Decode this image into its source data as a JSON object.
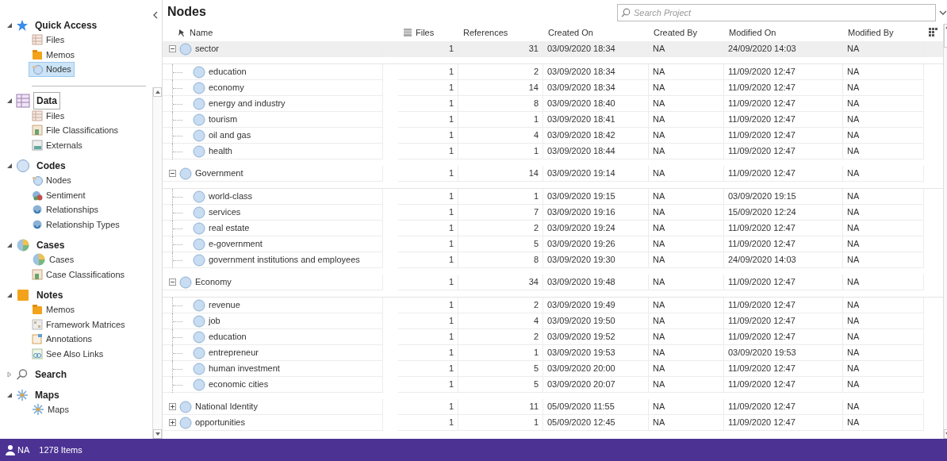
{
  "sidebar": {
    "quick_access": {
      "title": "Quick Access",
      "kind": "star",
      "expanded": true,
      "selected": false,
      "items": [
        {
          "label": "Files",
          "kind": "files",
          "selected": false
        },
        {
          "label": "Memos",
          "kind": "memos",
          "selected": false
        },
        {
          "label": "Nodes",
          "kind": "nodes",
          "selected": true
        }
      ]
    },
    "groups": [
      {
        "title": "Data",
        "kind": "data",
        "expanded": true,
        "selected": true,
        "items": [
          {
            "label": "Files",
            "kind": "files",
            "selected": false
          },
          {
            "label": "File Classifications",
            "kind": "classifications",
            "selected": false
          },
          {
            "label": "Externals",
            "kind": "externals",
            "selected": false
          }
        ]
      },
      {
        "title": "Codes",
        "kind": "codes",
        "expanded": true,
        "selected": false,
        "items": [
          {
            "label": "Nodes",
            "kind": "nodes",
            "selected": false
          },
          {
            "label": "Sentiment",
            "kind": "sentiment",
            "selected": false
          },
          {
            "label": "Relationships",
            "kind": "relationships",
            "selected": false
          },
          {
            "label": "Relationship Types",
            "kind": "relationships",
            "selected": false
          }
        ]
      },
      {
        "title": "Cases",
        "kind": "cases",
        "expanded": true,
        "selected": false,
        "items": [
          {
            "label": "Cases",
            "kind": "cases",
            "selected": false
          },
          {
            "label": "Case Classifications",
            "kind": "classifications",
            "selected": false
          }
        ]
      },
      {
        "title": "Notes",
        "kind": "notes",
        "expanded": true,
        "selected": false,
        "items": [
          {
            "label": "Memos",
            "kind": "memos",
            "selected": false
          },
          {
            "label": "Framework Matrices",
            "kind": "matrices",
            "selected": false
          },
          {
            "label": "Annotations",
            "kind": "annotations",
            "selected": false
          },
          {
            "label": "See Also Links",
            "kind": "links",
            "selected": false
          }
        ]
      },
      {
        "title": "Search",
        "kind": "search",
        "expanded": false,
        "selected": false
      },
      {
        "title": "Maps",
        "kind": "maps",
        "expanded": true,
        "selected": false,
        "items": [
          {
            "label": "Maps",
            "kind": "maps",
            "selected": false
          }
        ]
      }
    ]
  },
  "main": {
    "title": "Nodes",
    "search": {
      "placeholder": "Search Project"
    },
    "columns": [
      "Name",
      "Files",
      "References",
      "Created On",
      "Created By",
      "Modified On",
      "Modified By"
    ],
    "rows": [
      {
        "name": "sector",
        "files": "1",
        "references": "31",
        "created_on": "03/09/2020 18:34",
        "created_by": "NA",
        "modified_on": "24/09/2020 14:03",
        "modified_by": "NA",
        "expanded": true,
        "selected": true,
        "children": [
          {
            "name": "education",
            "files": "1",
            "references": "2",
            "created_on": "03/09/2020 18:34",
            "created_by": "NA",
            "modified_on": "11/09/2020 12:47",
            "modified_by": "NA",
            "selected": false
          },
          {
            "name": "economy",
            "files": "1",
            "references": "14",
            "created_on": "03/09/2020 18:34",
            "created_by": "NA",
            "modified_on": "11/09/2020 12:47",
            "modified_by": "NA",
            "selected": false
          },
          {
            "name": "energy and industry",
            "files": "1",
            "references": "8",
            "created_on": "03/09/2020 18:40",
            "created_by": "NA",
            "modified_on": "11/09/2020 12:47",
            "modified_by": "NA",
            "selected": false
          },
          {
            "name": "tourism",
            "files": "1",
            "references": "1",
            "created_on": "03/09/2020 18:41",
            "created_by": "NA",
            "modified_on": "11/09/2020 12:47",
            "modified_by": "NA",
            "selected": false
          },
          {
            "name": "oil and gas",
            "files": "1",
            "references": "4",
            "created_on": "03/09/2020 18:42",
            "created_by": "NA",
            "modified_on": "11/09/2020 12:47",
            "modified_by": "NA",
            "selected": false
          },
          {
            "name": "health",
            "files": "1",
            "references": "1",
            "created_on": "03/09/2020 18:44",
            "created_by": "NA",
            "modified_on": "11/09/2020 12:47",
            "modified_by": "NA",
            "selected": false
          }
        ]
      },
      {
        "name": "Government",
        "files": "1",
        "references": "14",
        "created_on": "03/09/2020 19:14",
        "created_by": "NA",
        "modified_on": "11/09/2020 12:47",
        "modified_by": "NA",
        "expanded": true,
        "selected": false,
        "children": [
          {
            "name": "world-class",
            "files": "1",
            "references": "1",
            "created_on": "03/09/2020 19:15",
            "created_by": "NA",
            "modified_on": "03/09/2020 19:15",
            "modified_by": "NA",
            "selected": false
          },
          {
            "name": "services",
            "files": "1",
            "references": "7",
            "created_on": "03/09/2020 19:16",
            "created_by": "NA",
            "modified_on": "15/09/2020 12:24",
            "modified_by": "NA",
            "selected": false
          },
          {
            "name": "real estate",
            "files": "1",
            "references": "2",
            "created_on": "03/09/2020 19:24",
            "created_by": "NA",
            "modified_on": "11/09/2020 12:47",
            "modified_by": "NA",
            "selected": false
          },
          {
            "name": "e-government",
            "files": "1",
            "references": "5",
            "created_on": "03/09/2020 19:26",
            "created_by": "NA",
            "modified_on": "11/09/2020 12:47",
            "modified_by": "NA",
            "selected": false
          },
          {
            "name": "government institutions and employees",
            "files": "1",
            "references": "8",
            "created_on": "03/09/2020 19:30",
            "created_by": "NA",
            "modified_on": "24/09/2020 14:03",
            "modified_by": "NA",
            "selected": false
          }
        ]
      },
      {
        "name": "Economy",
        "files": "1",
        "references": "34",
        "created_on": "03/09/2020 19:48",
        "created_by": "NA",
        "modified_on": "11/09/2020 12:47",
        "modified_by": "NA",
        "expanded": true,
        "selected": false,
        "children": [
          {
            "name": "revenue",
            "files": "1",
            "references": "2",
            "created_on": "03/09/2020 19:49",
            "created_by": "NA",
            "modified_on": "11/09/2020 12:47",
            "modified_by": "NA",
            "selected": false
          },
          {
            "name": "job",
            "files": "1",
            "references": "4",
            "created_on": "03/09/2020 19:50",
            "created_by": "NA",
            "modified_on": "11/09/2020 12:47",
            "modified_by": "NA",
            "selected": false
          },
          {
            "name": "education",
            "files": "1",
            "references": "2",
            "created_on": "03/09/2020 19:52",
            "created_by": "NA",
            "modified_on": "11/09/2020 12:47",
            "modified_by": "NA",
            "selected": false
          },
          {
            "name": "entrepreneur",
            "files": "1",
            "references": "1",
            "created_on": "03/09/2020 19:53",
            "created_by": "NA",
            "modified_on": "03/09/2020 19:53",
            "modified_by": "NA",
            "selected": false
          },
          {
            "name": "human investment",
            "files": "1",
            "references": "5",
            "created_on": "03/09/2020 20:00",
            "created_by": "NA",
            "modified_on": "11/09/2020 12:47",
            "modified_by": "NA",
            "selected": false
          },
          {
            "name": "economic cities",
            "files": "1",
            "references": "5",
            "created_on": "03/09/2020 20:07",
            "created_by": "NA",
            "modified_on": "11/09/2020 12:47",
            "modified_by": "NA",
            "selected": false
          }
        ]
      },
      {
        "name": "National Identity",
        "files": "1",
        "references": "11",
        "created_on": "05/09/2020 11:55",
        "created_by": "NA",
        "modified_on": "11/09/2020 12:47",
        "modified_by": "NA",
        "expanded": false,
        "selected": false
      },
      {
        "name": "opportunities",
        "files": "1",
        "references": "1",
        "created_on": "05/09/2020 12:45",
        "created_by": "NA",
        "modified_on": "11/09/2020 12:47",
        "modified_by": "NA",
        "expanded": false,
        "selected": false
      }
    ]
  },
  "status_bar": {
    "user": "NA",
    "count": "1278 Items"
  }
}
